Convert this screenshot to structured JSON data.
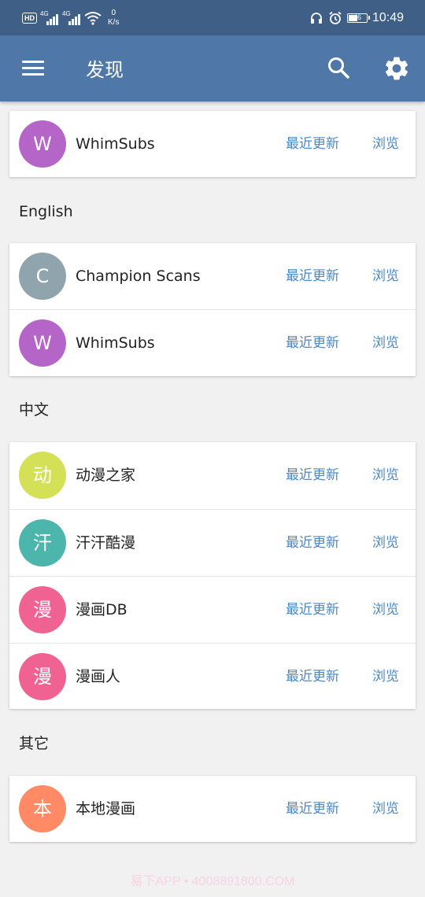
{
  "status_bar": {
    "hd": "HD",
    "net1": "4G",
    "net2": "4G",
    "speed_value": "0",
    "speed_unit": "K/s",
    "battery": "46",
    "time": "10:49"
  },
  "appbar": {
    "title": "发现"
  },
  "colors": {
    "statusbar": "#3f5f86",
    "appbar": "#4f77a7",
    "link": "#4a88c7",
    "background": "#f1f1f1"
  },
  "actions": {
    "latest_label": "最近更新",
    "browse_label": "浏览"
  },
  "sections": [
    {
      "header": "",
      "sources": [
        {
          "initial": "W",
          "name": "WhimSubs",
          "color": "#b565c8"
        }
      ]
    },
    {
      "header": "English",
      "sources": [
        {
          "initial": "C",
          "name": "Champion Scans",
          "color": "#90a4ae"
        },
        {
          "initial": "W",
          "name": "WhimSubs",
          "color": "#b565c8"
        }
      ]
    },
    {
      "header": "中文",
      "sources": [
        {
          "initial": "动",
          "name": "动漫之家",
          "color": "#d4e157"
        },
        {
          "initial": "汗",
          "name": "汗汗酷漫",
          "color": "#4db6ac"
        },
        {
          "initial": "漫",
          "name": "漫画DB",
          "color": "#f06292"
        },
        {
          "initial": "漫",
          "name": "漫画人",
          "color": "#f06292"
        }
      ]
    },
    {
      "header": "其它",
      "sources": [
        {
          "initial": "本",
          "name": "本地漫画",
          "color": "#ff8a65"
        }
      ]
    }
  ],
  "watermark": "易下APP • 4008891800.COM"
}
